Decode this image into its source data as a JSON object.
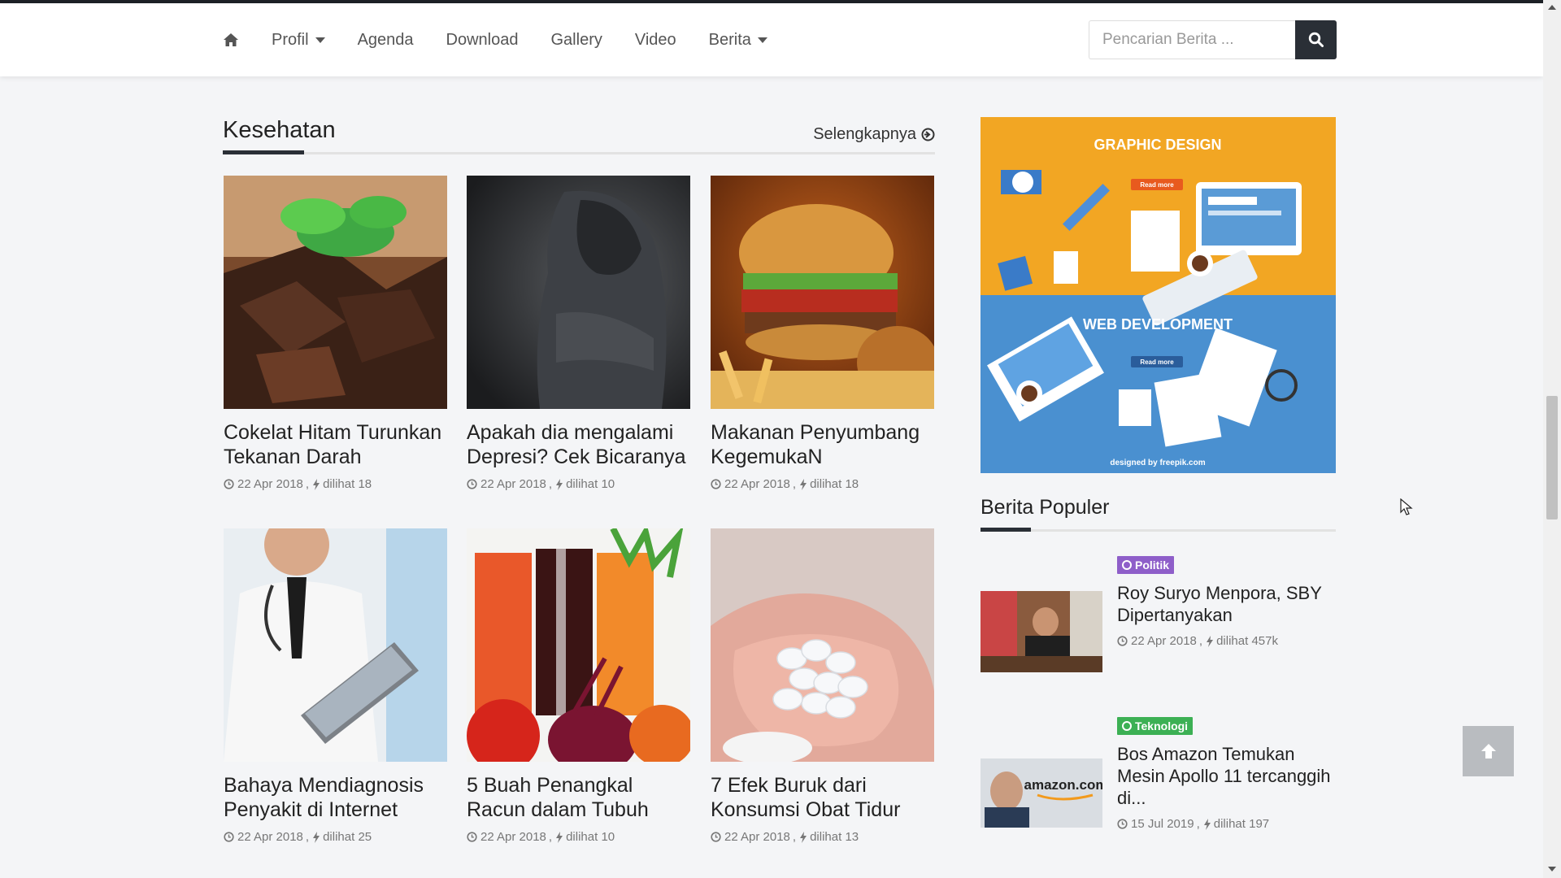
{
  "nav": {
    "home_icon": "home-icon",
    "items": [
      {
        "label": "Profil",
        "dropdown": true
      },
      {
        "label": "Agenda",
        "dropdown": false
      },
      {
        "label": "Download",
        "dropdown": false
      },
      {
        "label": "Gallery",
        "dropdown": false
      },
      {
        "label": "Video",
        "dropdown": false
      },
      {
        "label": "Berita",
        "dropdown": true
      }
    ],
    "search_placeholder": "Pencarian Berita ...",
    "search_icon": "search-icon"
  },
  "section": {
    "title": "Kesehatan",
    "more_label": "Selengkapnya"
  },
  "articles": [
    {
      "title": "Cokelat Hitam Turunkan Tekanan Darah",
      "date": "22 Apr 2018",
      "views": "dilihat 18"
    },
    {
      "title": "Apakah dia mengalami Depresi? Cek Bicaranya",
      "date": "22 Apr 2018",
      "views": "dilihat 10"
    },
    {
      "title": "Makanan Penyumbang KegemukaN",
      "date": "22 Apr 2018",
      "views": "dilihat 18"
    },
    {
      "title": "Bahaya Mendiagnosis Penyakit di Internet",
      "date": "22 Apr 2018",
      "views": "dilihat 25"
    },
    {
      "title": "5 Buah Penangkal Racun dalam Tubuh",
      "date": "22 Apr 2018",
      "views": "dilihat 10"
    },
    {
      "title": "7 Efek Buruk dari Konsumsi Obat Tidur",
      "date": "22 Apr 2018",
      "views": "dilihat 13"
    }
  ],
  "banner": {
    "top_title": "GRAPHIC DESIGN",
    "bottom_title": "WEB DEVELOPMENT",
    "read_more": "Read more",
    "credit": "designed by freepik.com",
    "top_color": "#f2a623",
    "bottom_color": "#4a90d0"
  },
  "popular": {
    "title": "Berita Populer",
    "items": [
      {
        "category": "Politik",
        "category_color": "#8e5ec9",
        "title": "Roy Suryo Menpora, SBY Dipertanyakan",
        "date": "22 Apr 2018",
        "views": "dilihat 457k"
      },
      {
        "category": "Teknologi",
        "category_color": "#3cb054",
        "title": "Bos Amazon Temukan Mesin Apollo 11 tercanggih di...",
        "date": "15 Jul 2019",
        "views": "dilihat 197",
        "thumb_text": "amazon.com"
      }
    ]
  },
  "back_to_top_icon": "arrow-up-icon"
}
